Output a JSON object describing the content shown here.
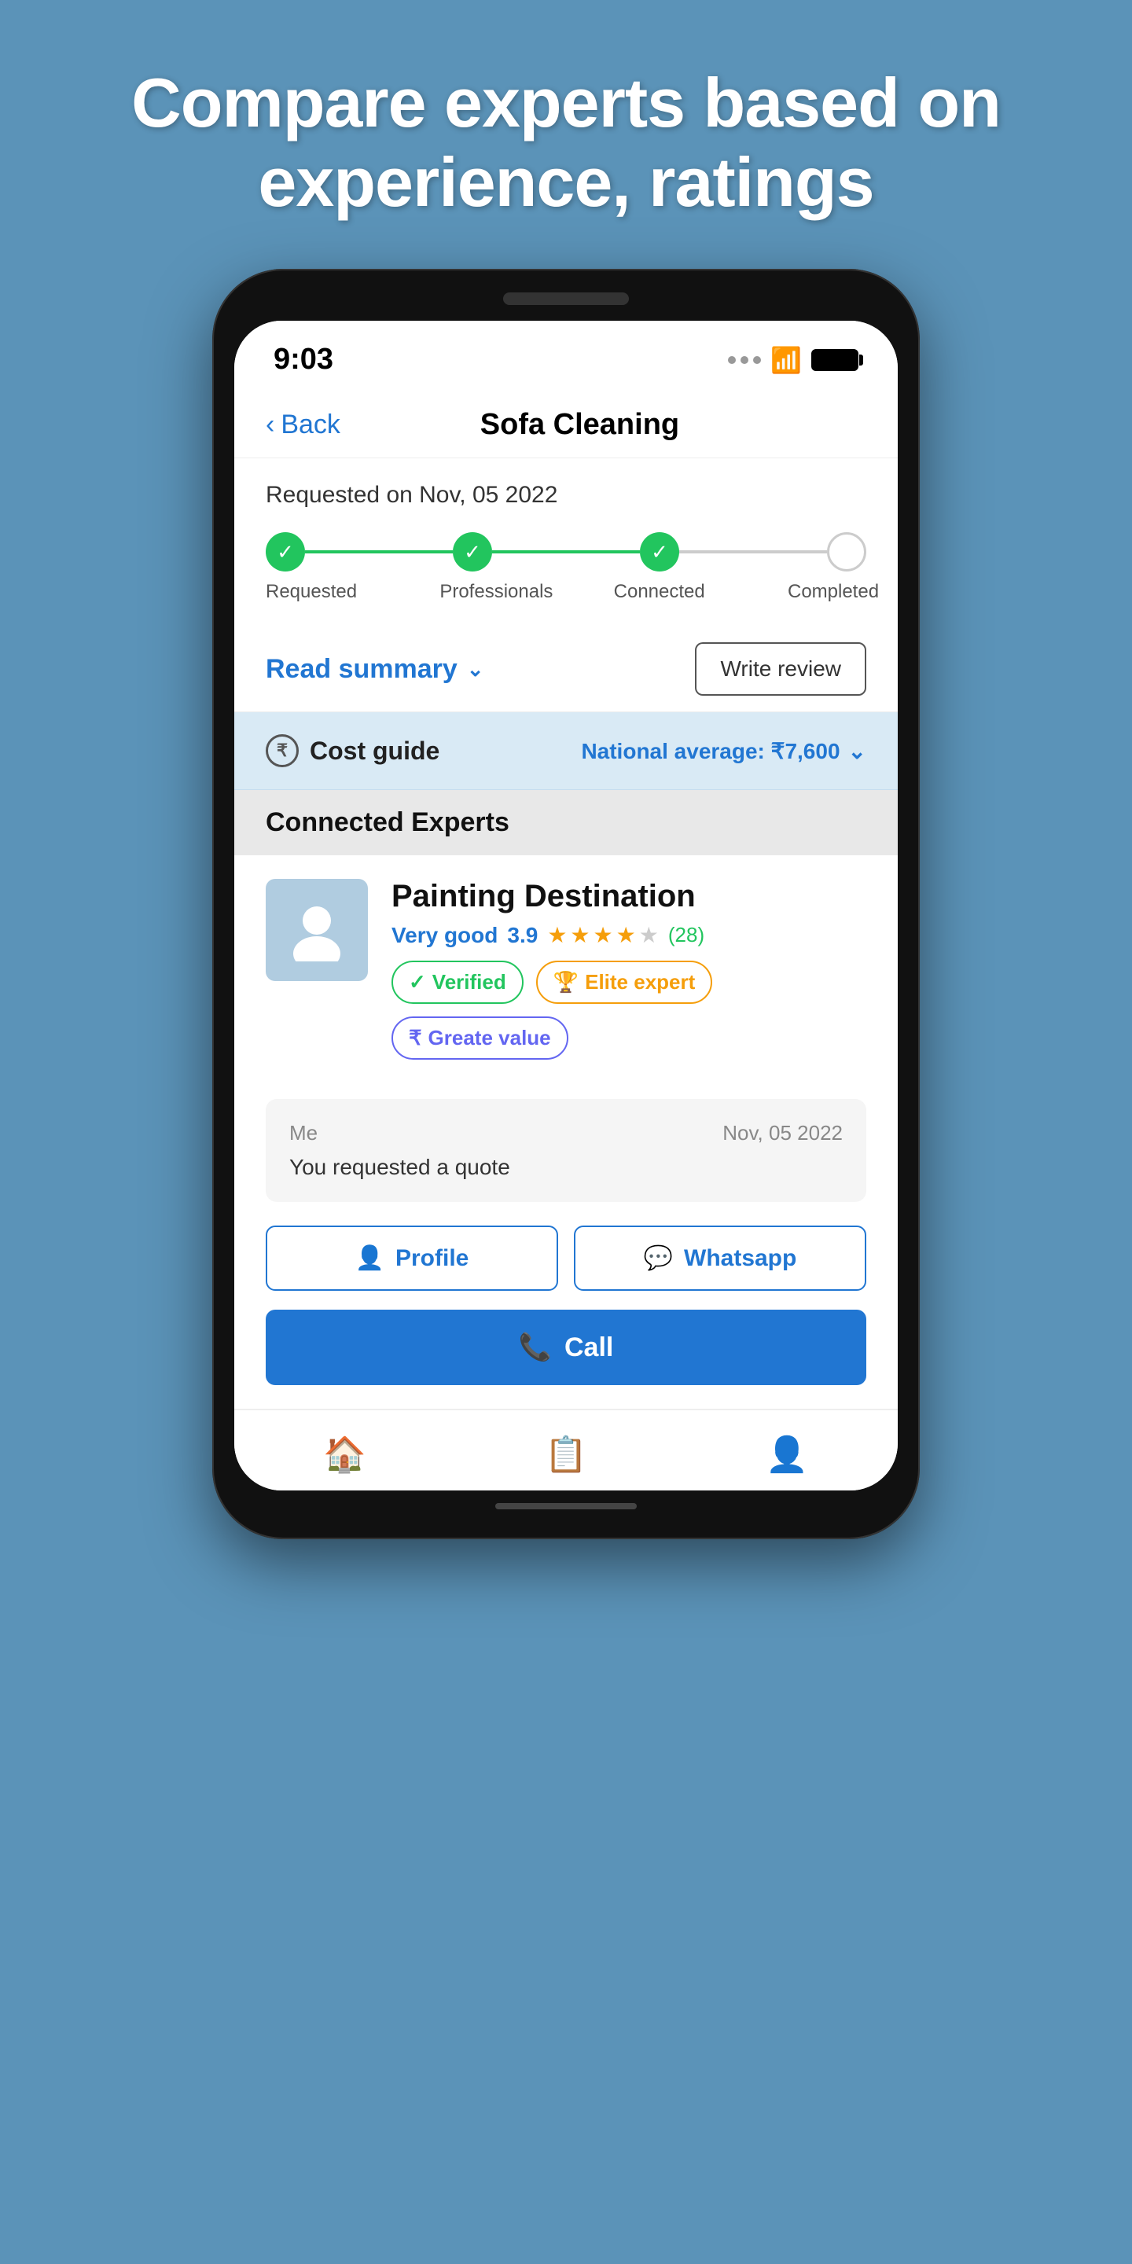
{
  "hero": {
    "title": "Compare experts based on experience, ratings"
  },
  "statusBar": {
    "time": "9:03"
  },
  "nav": {
    "backLabel": "Back",
    "title": "Sofa Cleaning"
  },
  "requestInfo": {
    "requestedDate": "Requested on Nov, 05 2022"
  },
  "progressSteps": [
    {
      "label": "Requested",
      "done": true
    },
    {
      "label": "Professionals",
      "done": true
    },
    {
      "label": "Connected",
      "done": true
    },
    {
      "label": "Completed",
      "done": false
    }
  ],
  "actions": {
    "readSummary": "Read summary",
    "writeReview": "Write review"
  },
  "costGuide": {
    "label": "Cost guide",
    "nationalAvg": "National average: ₹7,600"
  },
  "connectedExperts": {
    "sectionTitle": "Connected Experts",
    "expert": {
      "name": "Painting Destination",
      "ratingLabel": "Very good",
      "ratingNumber": "3.9",
      "reviewCount": "(28)",
      "badges": {
        "verified": "Verified",
        "elite": "Elite expert",
        "value": "Greate value"
      }
    },
    "message": {
      "sender": "Me",
      "date": "Nov, 05 2022",
      "text": "You requested a quote"
    }
  },
  "buttons": {
    "profile": "Profile",
    "whatsapp": "Whatsapp",
    "call": "Call"
  },
  "bottomNav": [
    {
      "icon": "🏠",
      "label": "Home",
      "active": false
    },
    {
      "icon": "📋",
      "label": "Bookings",
      "active": false
    },
    {
      "icon": "👤",
      "label": "Profile",
      "active": false
    }
  ],
  "colors": {
    "primary": "#2176d2",
    "green": "#22c55e",
    "amber": "#f59e0b",
    "purple": "#6366f1"
  }
}
